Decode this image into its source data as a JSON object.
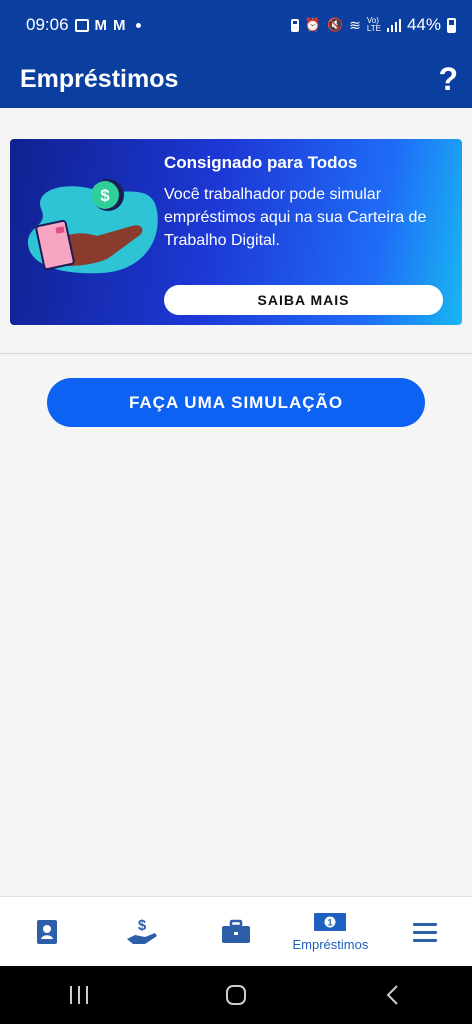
{
  "status_bar": {
    "time": "09:06",
    "battery": "44%"
  },
  "app_bar": {
    "title": "Empréstimos",
    "help_label": "?"
  },
  "banner": {
    "title": "Consignado para Todos",
    "text": "Você trabalhador pode simular empréstimos aqui na sua Carteira de Trabalho Digital.",
    "button_label": "SAIBA MAIS"
  },
  "main": {
    "simulate_label": "FAÇA UMA SIMULAÇÃO"
  },
  "bottom_nav": {
    "items": [
      {
        "icon": "profile-card-icon",
        "label": ""
      },
      {
        "icon": "hand-money-icon",
        "label": ""
      },
      {
        "icon": "briefcase-icon",
        "label": ""
      },
      {
        "icon": "banknote-icon",
        "label": "Empréstimos"
      },
      {
        "icon": "menu-icon",
        "label": ""
      }
    ]
  },
  "colors": {
    "primary": "#0a3fa0",
    "accent": "#0d62f4",
    "nav_active": "#1f5fbf"
  }
}
